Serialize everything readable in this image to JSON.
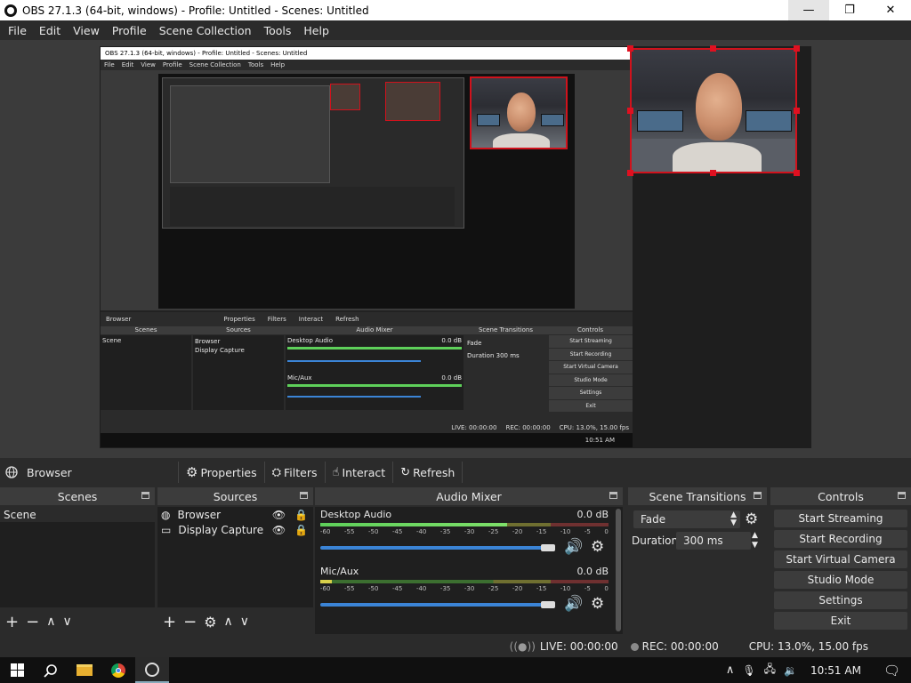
{
  "window": {
    "title": "OBS 27.1.3 (64-bit, windows) - Profile: Untitled - Scenes: Untitled",
    "minimize": "—",
    "restore": "❐",
    "close": "✕"
  },
  "menu": [
    "File",
    "Edit",
    "View",
    "Profile",
    "Scene Collection",
    "Tools",
    "Help"
  ],
  "nested": {
    "title": "OBS 27.1.3 (64-bit, windows) - Profile: Untitled - Scenes: Untitled",
    "menu": [
      "File",
      "Edit",
      "View",
      "Profile",
      "Scene Collection",
      "Tools",
      "Help"
    ],
    "source_name": "Browser",
    "toolbar": [
      "Properties",
      "Filters",
      "Interact",
      "Refresh"
    ],
    "docks": [
      "Scenes",
      "Sources",
      "Audio Mixer",
      "Scene Transitions",
      "Controls"
    ],
    "scene": "Scene",
    "sources": [
      "Browser",
      "Display Capture"
    ],
    "tracks": [
      "Desktop Audio",
      "Mic/Aux"
    ],
    "db": "0.0 dB",
    "transition": "Fade",
    "duration_label": "Duration",
    "duration": "300 ms",
    "controls": [
      "Start Streaming",
      "Start Recording",
      "Start Virtual Camera",
      "Studio Mode",
      "Settings",
      "Exit"
    ],
    "live": "LIVE: 00:00:00",
    "rec": "REC: 00:00:00",
    "cpu": "CPU: 13.0%, 15.00 fps",
    "clock": "10:51 AM"
  },
  "source_toolbar": {
    "source_name": "Browser",
    "properties": "Properties",
    "filters": "Filters",
    "interact": "Interact",
    "refresh": "Refresh"
  },
  "docks": {
    "scenes": {
      "title": "Scenes",
      "items": [
        "Scene"
      ]
    },
    "sources": {
      "title": "Sources",
      "items": [
        "Browser",
        "Display Capture"
      ]
    },
    "mixer": {
      "title": "Audio Mixer",
      "tracks": [
        {
          "name": "Desktop Audio",
          "db": "0.0 dB"
        },
        {
          "name": "Mic/Aux",
          "db": "0.0 dB"
        }
      ],
      "ticks": [
        "-60",
        "-55",
        "-50",
        "-45",
        "-40",
        "-35",
        "-30",
        "-25",
        "-20",
        "-15",
        "-10",
        "-5",
        "0"
      ]
    },
    "transitions": {
      "title": "Scene Transitions",
      "transition": "Fade",
      "duration_label": "Duration",
      "duration": "300 ms"
    },
    "controls": {
      "title": "Controls",
      "start_streaming": "Start Streaming",
      "start_recording": "Start Recording",
      "start_virtual_camera": "Start Virtual Camera",
      "studio_mode": "Studio Mode",
      "settings": "Settings",
      "exit": "Exit"
    }
  },
  "status": {
    "live": "LIVE: 00:00:00",
    "rec": "REC: 00:00:00",
    "cpu": "CPU: 13.0%, 15.00 fps"
  },
  "taskbar": {
    "clock": "10:51 AM"
  },
  "icons": {
    "start": "windows-start-icon",
    "search": "search-icon",
    "files": "file-explorer-icon",
    "chrome": "chrome-icon",
    "obs": "obs-icon",
    "chevron_up": "chevron-up-icon",
    "mic": "microphone-icon",
    "network": "network-icon",
    "volume": "volume-icon",
    "notifications": "notifications-icon"
  },
  "colors": {
    "accent": "#3b84d6",
    "selection": "#d0121c",
    "meter_green": "#5ed05a"
  }
}
